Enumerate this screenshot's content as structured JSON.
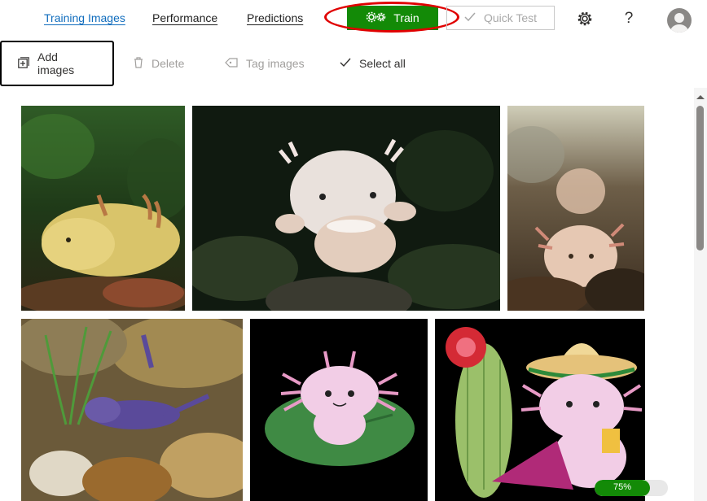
{
  "tabs": [
    {
      "label": "Training Images",
      "active": true
    },
    {
      "label": "Performance",
      "active": false
    },
    {
      "label": "Predictions",
      "active": false
    }
  ],
  "train_label": "Train",
  "quick_test_label": "Quick Test",
  "help_label": "?",
  "toolbar": {
    "add_images": "Add images",
    "delete": "Delete",
    "tag_images": "Tag images",
    "select_all": "Select all"
  },
  "progress": {
    "value": 0.75,
    "label": "75%"
  },
  "colors": {
    "accent": "#0f6cbd",
    "train_green": "#138a07",
    "highlight": "#e00000"
  },
  "images": [
    "axolotl-golden-photo",
    "axolotl-white-photo",
    "axolotl-pink-photo",
    "axolotl-purple-photo",
    "axolotl-cartoon-lilypad",
    "axolotl-cartoon-sombrero"
  ]
}
